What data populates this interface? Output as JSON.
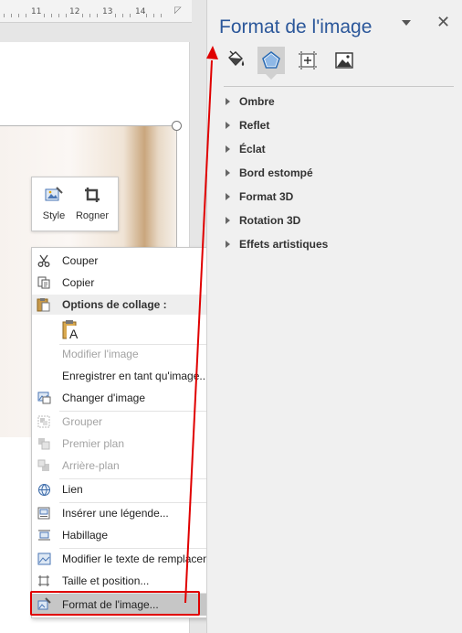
{
  "ruler": {
    "numbers": [
      "11",
      "12",
      "13",
      "14",
      "15"
    ]
  },
  "mini_toolbar": {
    "style_label": "Style",
    "crop_label": "Rogner"
  },
  "context_menu": {
    "items": [
      {
        "label": "Couper",
        "icon": "scissors-icon",
        "enabled": true
      },
      {
        "label": "Copier",
        "icon": "copy-icon",
        "enabled": true
      },
      {
        "label": "Options de collage :",
        "icon": "clipboard-icon",
        "header": true
      },
      {
        "label": "Modifier l'image",
        "enabled": false
      },
      {
        "label": "Enregistrer en tant qu'image...",
        "enabled": true
      },
      {
        "label": "Changer d'image",
        "icon": "change-picture-icon",
        "enabled": true,
        "submenu": true
      },
      {
        "label": "Grouper",
        "icon": "group-icon",
        "enabled": false,
        "submenu": true
      },
      {
        "label": "Premier plan",
        "icon": "bring-forward-icon",
        "enabled": false,
        "submenu": true
      },
      {
        "label": "Arrière-plan",
        "icon": "send-backward-icon",
        "enabled": false,
        "submenu": true
      },
      {
        "label": "Lien",
        "icon": "link-icon",
        "enabled": true
      },
      {
        "label": "Insérer une légende...",
        "icon": "caption-icon",
        "enabled": true
      },
      {
        "label": "Habillage",
        "icon": "wrap-text-icon",
        "enabled": true,
        "submenu": true
      },
      {
        "label": "Modifier le texte de remplacement...",
        "icon": "alt-text-icon",
        "enabled": true
      },
      {
        "label": "Taille et position...",
        "icon": "size-position-icon",
        "enabled": true
      },
      {
        "label": "Format de l'image...",
        "icon": "format-picture-icon",
        "enabled": true,
        "selected": true
      }
    ]
  },
  "pane": {
    "title": "Format de l'image",
    "tabs": [
      "fill-line-icon",
      "effects-icon",
      "layout-properties-icon",
      "picture-icon"
    ],
    "active_tab": "effects-icon",
    "sections": [
      "Ombre",
      "Reflet",
      "Éclat",
      "Bord estompé",
      "Format 3D",
      "Rotation 3D",
      "Effets artistiques"
    ]
  },
  "colors": {
    "accent": "#2b579a",
    "highlight": "#e00000",
    "selected_item": "#c6c6c6"
  }
}
